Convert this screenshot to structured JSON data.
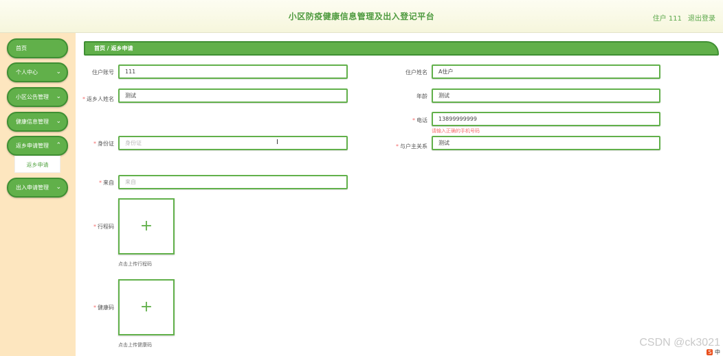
{
  "header": {
    "title": "小区防疫健康信息管理及出入登记平台",
    "user_label": "住户 111",
    "logout_label": "退出登录"
  },
  "sidebar": {
    "items": [
      {
        "label": "首页"
      },
      {
        "label": "个人中心"
      },
      {
        "label": "小区公告管理"
      },
      {
        "label": "健康信息管理"
      },
      {
        "label": "返乡申请管理"
      },
      {
        "label": "出入申请管理"
      }
    ],
    "sub_item": "返乡申请"
  },
  "breadcrumb": "首页 / 返乡申请",
  "form": {
    "account_label": "住户账号",
    "account_value": "111",
    "name_label": "住户姓名",
    "name_value": "A住户",
    "return_name_label": "返乡人姓名",
    "return_name_value": "测试",
    "age_label": "年龄",
    "age_value": "测试",
    "phone_label": "电话",
    "phone_value": "13899999999",
    "phone_error": "请输入正确的手机号码",
    "id_label": "身份证",
    "id_placeholder": "身份证",
    "relation_label": "与户主关系",
    "relation_value": "测试",
    "origin_label": "来自",
    "origin_placeholder": "来自",
    "trip_code_label": "行程码",
    "trip_code_hint": "点击上传行程码",
    "health_code_label": "健康码",
    "health_code_hint": "点击上传健康码"
  },
  "watermark": "CSDN @ck3021",
  "ime_label": "中",
  "colors": {
    "accent": "#61b04a",
    "accent_dark": "#3f8f33",
    "sidebar_bg": "#fde6bf",
    "error": "#f56c6c"
  }
}
